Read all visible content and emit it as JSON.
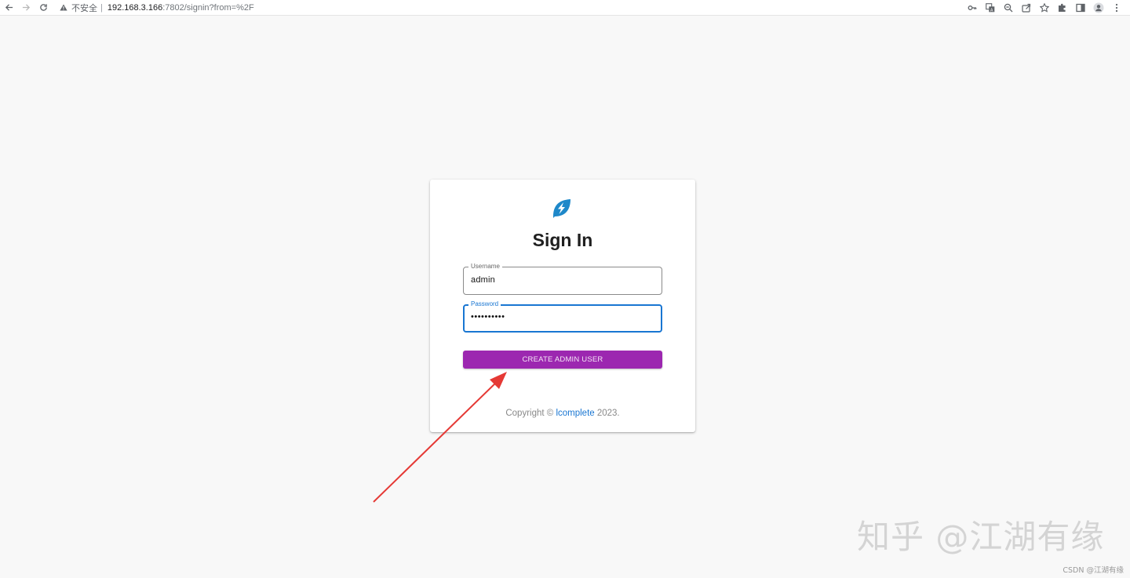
{
  "browser": {
    "back_icon": "arrow-left",
    "forward_icon": "arrow-right",
    "reload_icon": "reload",
    "security_label": "不安全",
    "separator": "|",
    "url_host": "192.168.3.166",
    "url_path": ":7802/signin?from=%2F",
    "toolbar_icons": [
      "key-icon",
      "translate-icon",
      "zoom-icon",
      "share-icon",
      "star-icon",
      "extensions-icon",
      "side-panel-icon",
      "profile-icon",
      "menu-icon"
    ]
  },
  "signin": {
    "logo_icon": "leaf-bolt-logo",
    "title": "Sign In",
    "username": {
      "label": "Username",
      "value": "admin"
    },
    "password": {
      "label": "Password",
      "value": "••••••••••"
    },
    "submit_label": "CREATE ADMIN USER",
    "footer": {
      "prefix": "Copyright © ",
      "brand": "lcomplete",
      "suffix": " 2023."
    }
  },
  "colors": {
    "accent_purple": "#9c27b0",
    "focus_blue": "#1976d2",
    "logo_blue": "#1e88c9",
    "arrow_red": "#e53935"
  },
  "watermark": {
    "large": "知乎 @江湖有缘",
    "small": "CSDN @江湖有缘"
  }
}
